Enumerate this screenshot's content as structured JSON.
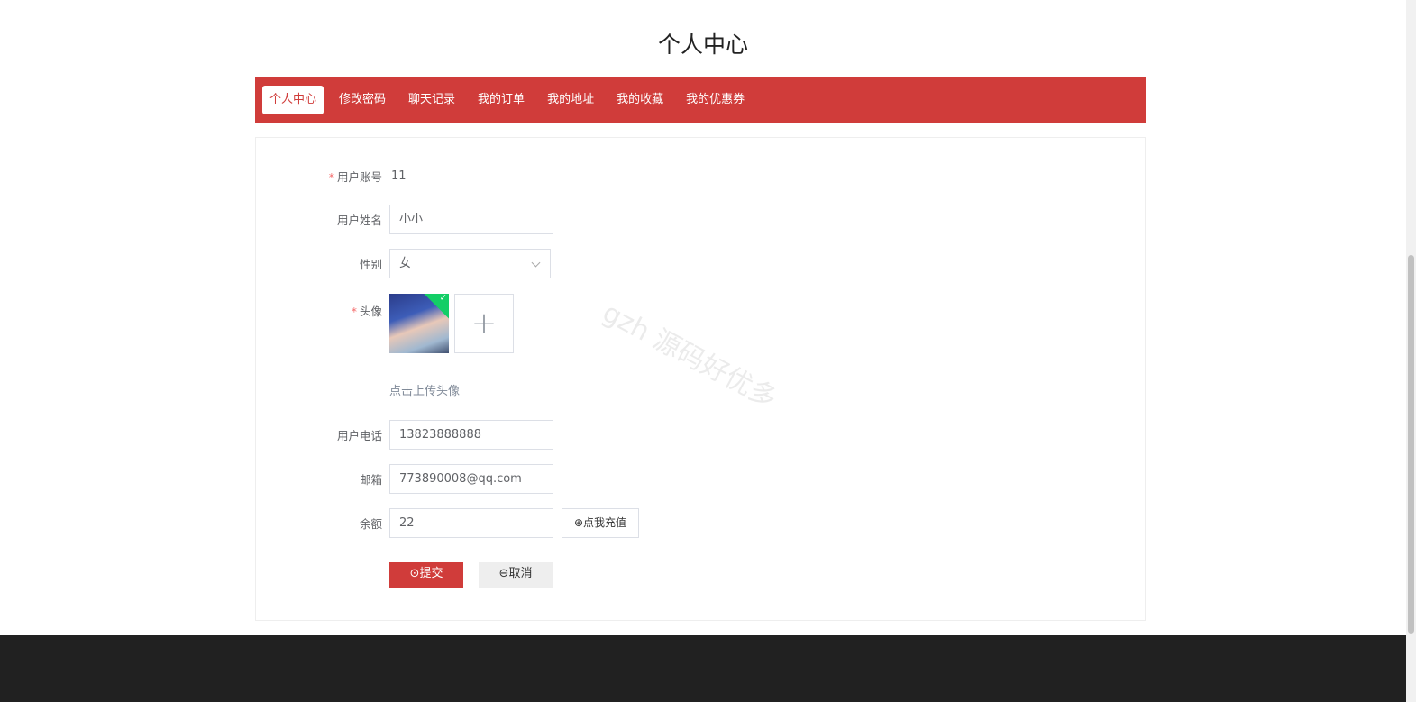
{
  "page_title": "个人中心",
  "nav": [
    {
      "label": "个人中心",
      "active": true
    },
    {
      "label": "修改密码"
    },
    {
      "label": "聊天记录"
    },
    {
      "label": "我的订单"
    },
    {
      "label": "我的地址"
    },
    {
      "label": "我的收藏"
    },
    {
      "label": "我的优惠券"
    }
  ],
  "form": {
    "account_label": "用户账号",
    "account_value": "11",
    "name_label": "用户姓名",
    "name_value": "小小",
    "gender_label": "性别",
    "gender_value": "女",
    "avatar_label": "头像",
    "avatar_hint": "点击上传头像",
    "plus": "+",
    "phone_label": "用户电话",
    "phone_value": "13823888888",
    "email_label": "邮箱",
    "email_value": "773890008@qq.com",
    "balance_label": "余额",
    "balance_value": "22",
    "recharge_label": "⊕点我充值",
    "submit_label": "⊙提交",
    "cancel_label": "⊖取消",
    "required_mark": "*"
  },
  "watermark": "gzh 源码好优多",
  "colors": {
    "accent": "#d03c3a",
    "footer": "#212121"
  }
}
